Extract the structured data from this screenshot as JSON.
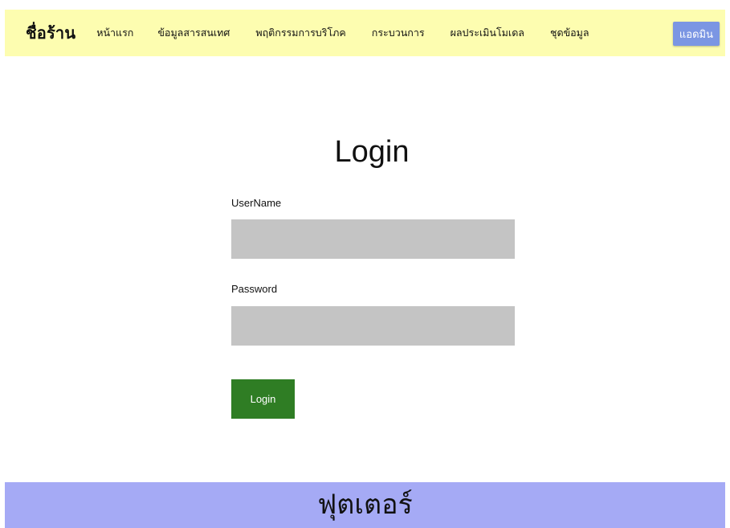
{
  "nav": {
    "brand": "ชื่อร้าน",
    "items": [
      {
        "label": "หน้าแรก"
      },
      {
        "label": "ข้อมูลสารสนเทศ"
      },
      {
        "label": "พฤติกรรมการบริโภค"
      },
      {
        "label": "กระบวนการ"
      },
      {
        "label": "ผลประเมินโมเดล"
      },
      {
        "label": "ชุดข้อมูล"
      }
    ],
    "admin_label": "แอดมิน"
  },
  "login": {
    "title": "Login",
    "username_label": "UserName",
    "username_value": "",
    "password_label": "Password",
    "password_value": "",
    "submit_label": "Login"
  },
  "footer": {
    "text": "ฟุตเตอร์"
  },
  "colors": {
    "nav_bg": "#fdfdb0",
    "admin_bg": "#7b96e3",
    "input_bg": "#c4c4c4",
    "button_bg": "#2f7d24",
    "footer_bg": "#a5aaf5"
  }
}
